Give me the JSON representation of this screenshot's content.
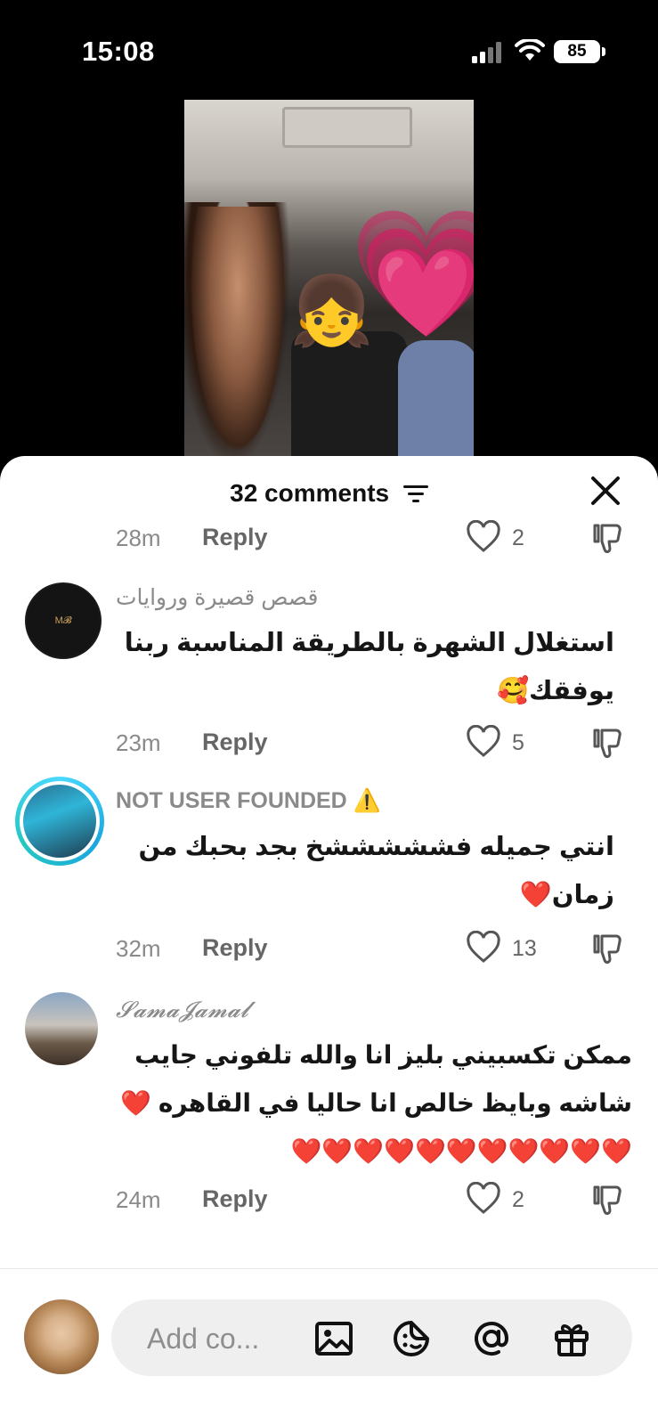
{
  "status_bar": {
    "time": "15:08",
    "battery": "85"
  },
  "sheet": {
    "title": "32 comments"
  },
  "comments": [
    {
      "time": "28m",
      "reply": "Reply",
      "likes": "2"
    },
    {
      "username": "قصص قصيرة وروايات",
      "text": "استغلال الشهرة بالطريقة المناسبة ربنا يوفقك🥰",
      "time": "23m",
      "reply": "Reply",
      "likes": "5"
    },
    {
      "username": "NOT USER FOUNDED ⚠️",
      "text": "انتي جميله فشششششخ بجد بحبك من زمان❤️",
      "time": "32m",
      "reply": "Reply",
      "likes": "13"
    },
    {
      "username": "𝓢𝓪𝓶𝓪𝓙𝓪𝓶𝓪𝓵",
      "text": "ممكن تكسبيني بليز انا والله تلفوني جايب شاشه وبايظ خالص انا حاليا في القاهره ❤️❤️❤️❤️❤️❤️❤️❤️❤️❤️❤️❤️",
      "time": "24m",
      "reply": "Reply",
      "likes": "2"
    }
  ],
  "composer": {
    "placeholder": "Add co..."
  },
  "icons": [
    "signal-icon",
    "wifi-icon",
    "filter-icon",
    "close-icon",
    "heart-icon",
    "dislike-icon",
    "image-icon",
    "emoji-icon",
    "mention-icon",
    "gift-icon"
  ]
}
